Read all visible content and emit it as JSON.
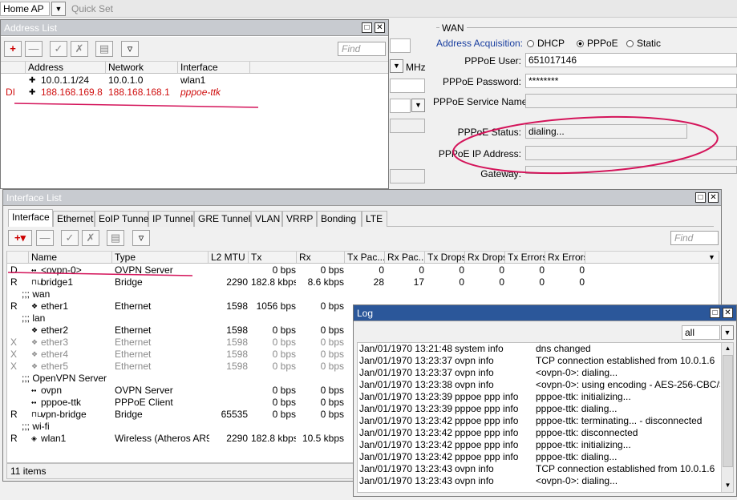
{
  "top": {
    "mode_select": "Home AP",
    "quick_set": "Quick Set"
  },
  "wan": {
    "group_title": "WAN",
    "address_acquisition_label": "Address Acquisition:",
    "options": [
      "DHCP",
      "PPPoE",
      "Static"
    ],
    "selected": "PPPoE",
    "pppoe_user_label": "PPPoE User:",
    "pppoe_user": "651017146",
    "pppoe_password_label": "PPPoE Password:",
    "pppoe_password": "********",
    "pppoe_service_label": "PPPoE Service Name:",
    "pppoe_status_label": "PPPoE Status:",
    "pppoe_status": "dialing...",
    "pppoe_ip_label": "PPPoE IP Address:",
    "gateway_label": "Gateway:",
    "mhz": "MHz"
  },
  "address_list": {
    "title": "Address List",
    "find_placeholder": "Find",
    "columns": [
      "Address",
      "Network",
      "Interface"
    ],
    "rows": [
      {
        "flag": "",
        "address": "10.0.1.1/24",
        "network": "10.0.1.0",
        "interface": "wlan1"
      },
      {
        "flag": "DI",
        "address": "188.168.169.8",
        "network": "188.168.168.1",
        "interface": "pppoe-ttk"
      }
    ]
  },
  "interface_list": {
    "title": "Interface List",
    "tabs": [
      "Interface",
      "Ethernet",
      "EoIP Tunnel",
      "IP Tunnel",
      "GRE Tunnel",
      "VLAN",
      "VRRP",
      "Bonding",
      "LTE"
    ],
    "active_tab": "Interface",
    "find_placeholder": "Find",
    "columns": [
      "Name",
      "Type",
      "L2 MTU",
      "Tx",
      "Rx",
      "Tx Pac...",
      "Rx Pac...",
      "Tx Drops",
      "Rx Drops",
      "Tx Errors",
      "Rx Errors"
    ],
    "rows": [
      {
        "kind": "row",
        "flag": "D",
        "name": "<ovpn-0>",
        "type": "OVPN Server",
        "mtu": "",
        "tx": "0 bps",
        "rx": "0 bps",
        "txp": "0",
        "rxp": "0",
        "txd": "0",
        "rxd": "0",
        "txe": "0",
        "rxe": "0",
        "icon": "ovpn"
      },
      {
        "kind": "row",
        "flag": "R",
        "name": "bridge1",
        "type": "Bridge",
        "mtu": "2290",
        "tx": "182.8 kbps",
        "rx": "8.6 kbps",
        "txp": "28",
        "rxp": "17",
        "txd": "0",
        "rxd": "0",
        "txe": "0",
        "rxe": "0",
        "icon": "bridge"
      },
      {
        "kind": "group",
        "label": ";;; wan"
      },
      {
        "kind": "row",
        "flag": "R",
        "name": "ether1",
        "type": "Ethernet",
        "mtu": "1598",
        "tx": "1056 bps",
        "rx": "0 bps",
        "txp": "",
        "rxp": "",
        "txd": "",
        "rxd": "",
        "txe": "",
        "rxe": "",
        "icon": "eth"
      },
      {
        "kind": "group",
        "label": ";;; lan"
      },
      {
        "kind": "row",
        "flag": "",
        "name": "ether2",
        "type": "Ethernet",
        "mtu": "1598",
        "tx": "0 bps",
        "rx": "0 bps",
        "icon": "eth"
      },
      {
        "kind": "row",
        "flag": "X",
        "name": "ether3",
        "type": "Ethernet",
        "mtu": "1598",
        "tx": "0 bps",
        "rx": "0 bps",
        "icon": "eth",
        "disabled": true
      },
      {
        "kind": "row",
        "flag": "X",
        "name": "ether4",
        "type": "Ethernet",
        "mtu": "1598",
        "tx": "0 bps",
        "rx": "0 bps",
        "icon": "eth",
        "disabled": true
      },
      {
        "kind": "row",
        "flag": "X",
        "name": "ether5",
        "type": "Ethernet",
        "mtu": "1598",
        "tx": "0 bps",
        "rx": "0 bps",
        "icon": "eth",
        "disabled": true
      },
      {
        "kind": "group",
        "label": ";;; OpenVPN Server"
      },
      {
        "kind": "row",
        "flag": "",
        "name": "ovpn",
        "type": "OVPN Server",
        "mtu": "",
        "tx": "0 bps",
        "rx": "0 bps",
        "icon": "ovpn"
      },
      {
        "kind": "row",
        "flag": "",
        "name": "pppoe-ttk",
        "type": "PPPoE Client",
        "mtu": "",
        "tx": "0 bps",
        "rx": "0 bps",
        "icon": "ovpn"
      },
      {
        "kind": "row",
        "flag": "R",
        "name": "vpn-bridge",
        "type": "Bridge",
        "mtu": "65535",
        "tx": "0 bps",
        "rx": "0 bps",
        "icon": "bridge"
      },
      {
        "kind": "group",
        "label": ";;; wi-fi"
      },
      {
        "kind": "row",
        "flag": "R",
        "name": "wlan1",
        "type": "Wireless (Atheros AR9...",
        "mtu": "2290",
        "tx": "182.8 kbps",
        "rx": "10.5 kbps",
        "icon": "wlan"
      }
    ],
    "status": "11 items"
  },
  "log": {
    "title": "Log",
    "filter": "all",
    "entries": [
      {
        "time": "Jan/01/1970 13:21:48",
        "topic": "system info",
        "msg": "dns changed"
      },
      {
        "time": "Jan/01/1970 13:23:37",
        "topic": "ovpn info",
        "msg": "TCP connection established from 10.0.1.6"
      },
      {
        "time": "Jan/01/1970 13:23:37",
        "topic": "ovpn info",
        "msg": "<ovpn-0>: dialing..."
      },
      {
        "time": "Jan/01/1970 13:23:38",
        "topic": "ovpn info",
        "msg": "<ovpn-0>: using encoding - AES-256-CBC/SHA1"
      },
      {
        "time": "Jan/01/1970 13:23:39",
        "topic": "pppoe ppp info",
        "msg": "pppoe-ttk: initializing..."
      },
      {
        "time": "Jan/01/1970 13:23:39",
        "topic": "pppoe ppp info",
        "msg": "pppoe-ttk: dialing..."
      },
      {
        "time": "Jan/01/1970 13:23:42",
        "topic": "pppoe ppp info",
        "msg": "pppoe-ttk: terminating... - disconnected"
      },
      {
        "time": "Jan/01/1970 13:23:42",
        "topic": "pppoe ppp info",
        "msg": "pppoe-ttk: disconnected"
      },
      {
        "time": "Jan/01/1970 13:23:42",
        "topic": "pppoe ppp info",
        "msg": "pppoe-ttk: initializing..."
      },
      {
        "time": "Jan/01/1970 13:23:42",
        "topic": "pppoe ppp info",
        "msg": "pppoe-ttk: dialing..."
      },
      {
        "time": "Jan/01/1970 13:23:43",
        "topic": "ovpn info",
        "msg": "TCP connection established from 10.0.1.6"
      },
      {
        "time": "Jan/01/1970 13:23:43",
        "topic": "ovpn info",
        "msg": "<ovpn-0>: dialing..."
      }
    ]
  },
  "colors": {
    "annotation": "#d4145a",
    "disabled_flag": "#d01010",
    "title_active": "#2b579a"
  }
}
